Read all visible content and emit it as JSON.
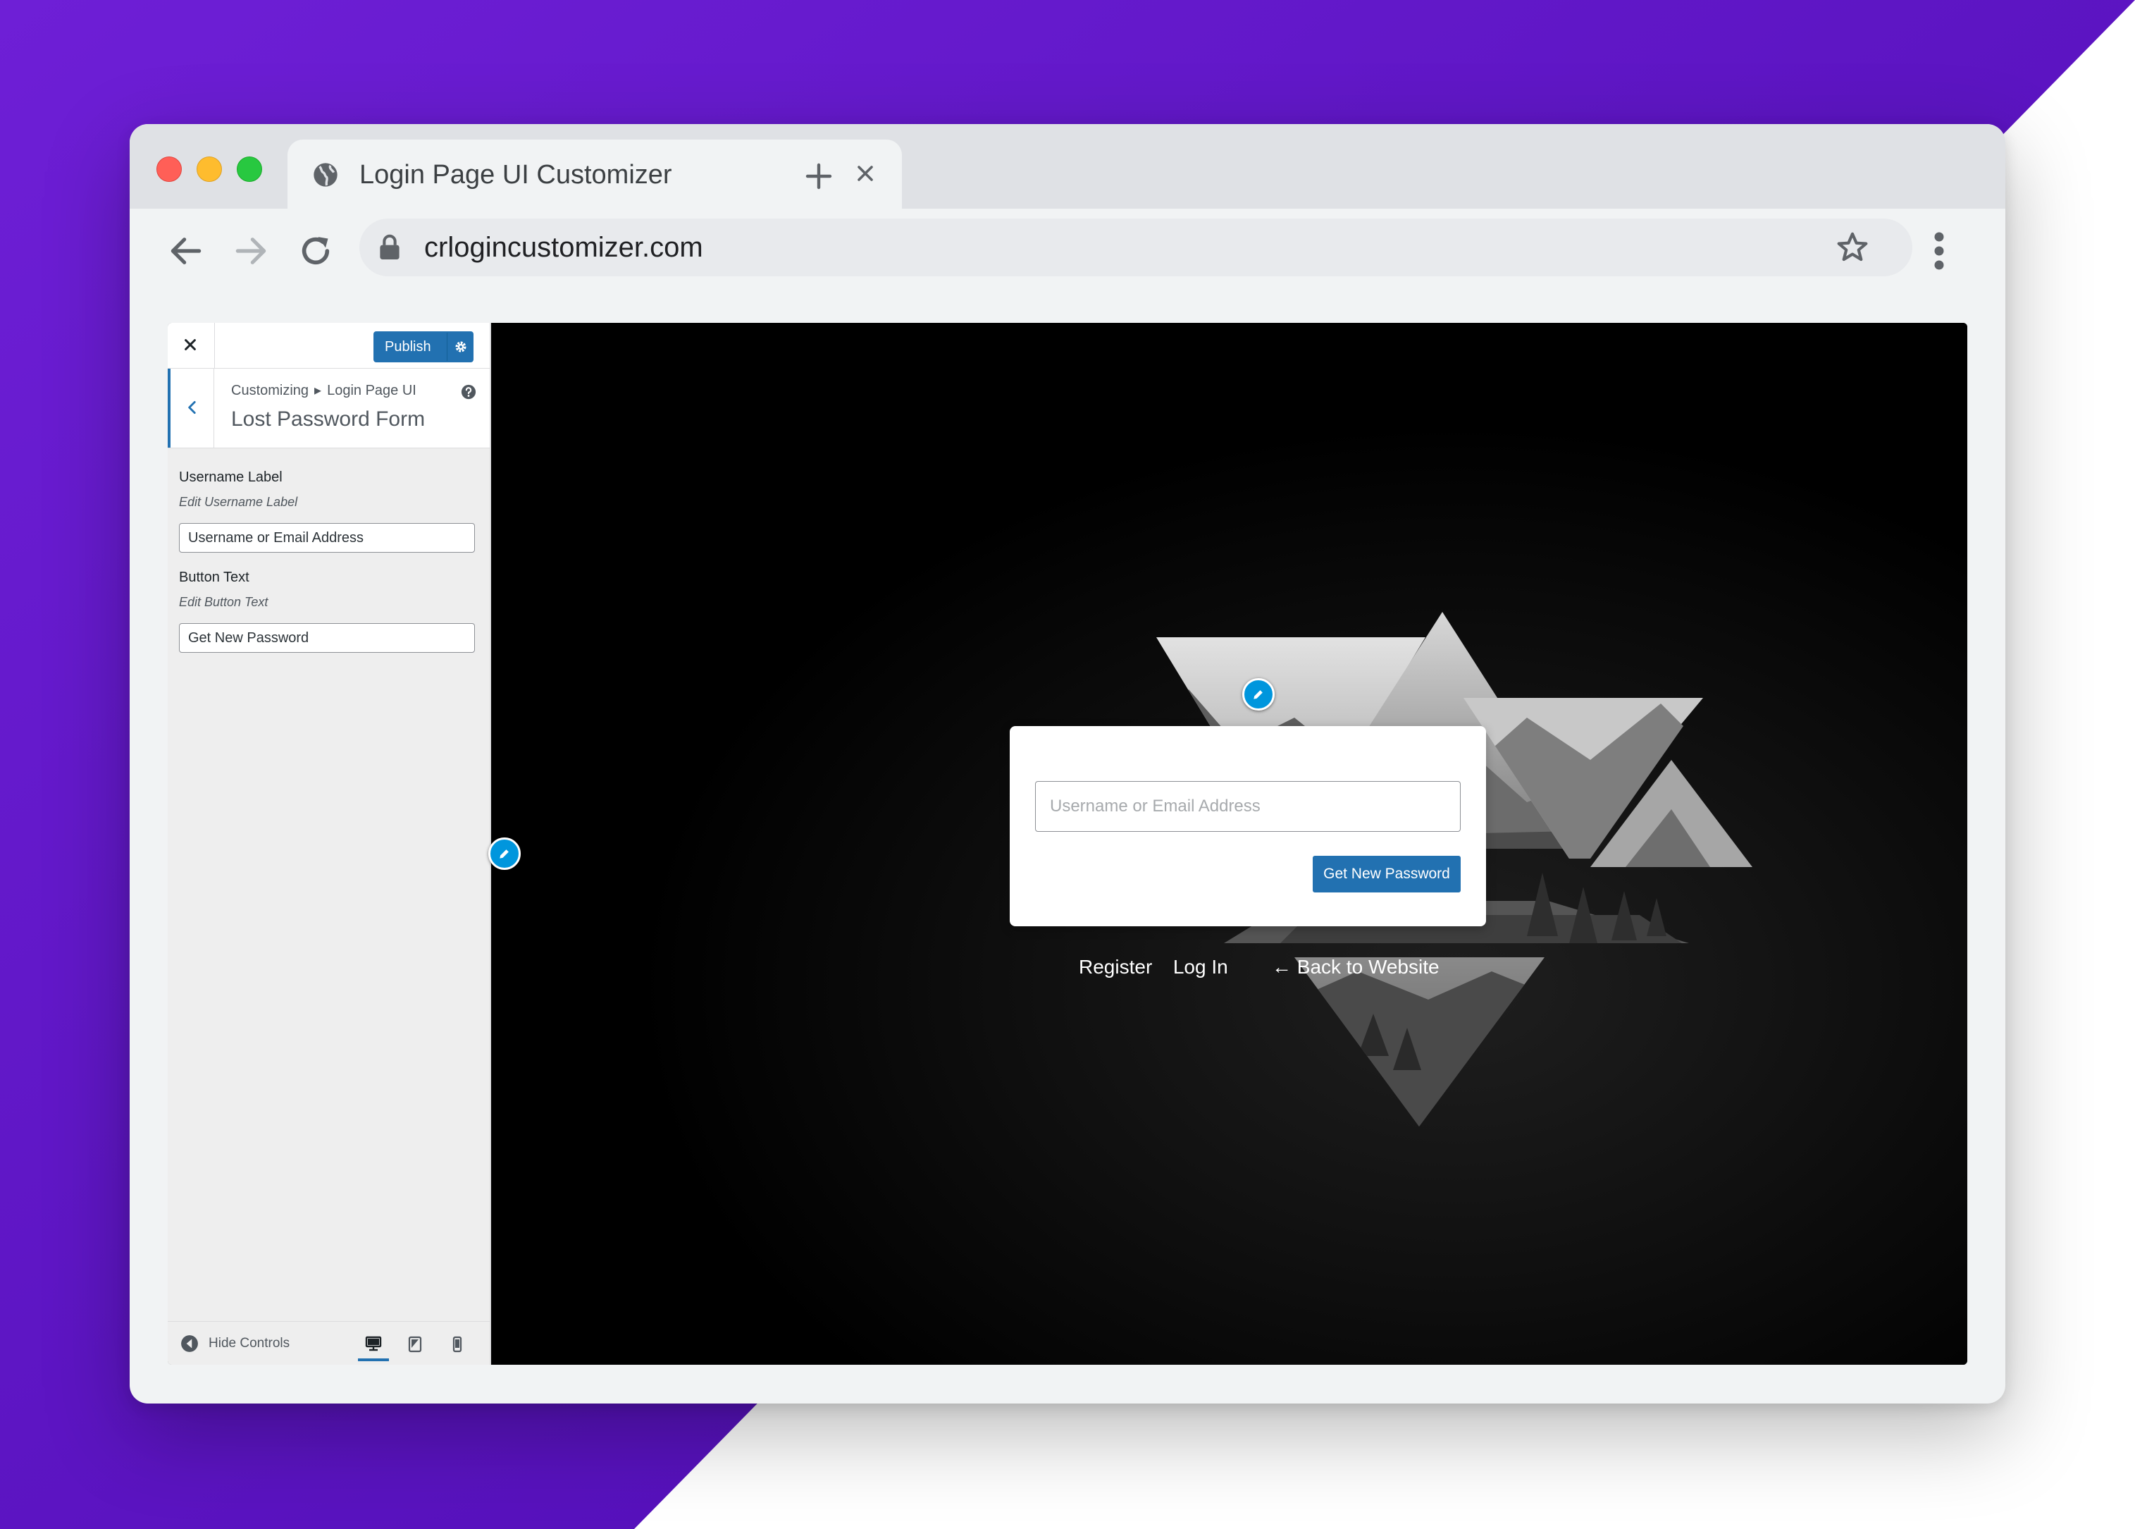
{
  "browser": {
    "tab_title": "Login Page UI Customizer",
    "url": "crlogincustomizer.com"
  },
  "customizer": {
    "publish_label": "Publish",
    "breadcrumb": [
      "Customizing",
      "Login Page UI"
    ],
    "section_title": "Lost Password Form",
    "fields": [
      {
        "label": "Username Label",
        "description": "Edit Username Label",
        "value": "Username or Email Address"
      },
      {
        "label": "Button Text",
        "description": "Edit Button Text",
        "value": "Get New Password"
      }
    ],
    "hide_controls_label": "Hide Controls",
    "devices": [
      "desktop-icon",
      "tablet-icon",
      "mobile-icon"
    ],
    "active_device": "desktop"
  },
  "login_preview": {
    "input_placeholder": "Username or Email Address",
    "button_label": "Get New Password",
    "links": [
      "Register",
      "Log In"
    ],
    "back_link": "← Back to Website"
  },
  "colors": {
    "accent": "#2271b1",
    "edit_pencil": "#0096dd",
    "background_purple": "#6a1bd0"
  }
}
